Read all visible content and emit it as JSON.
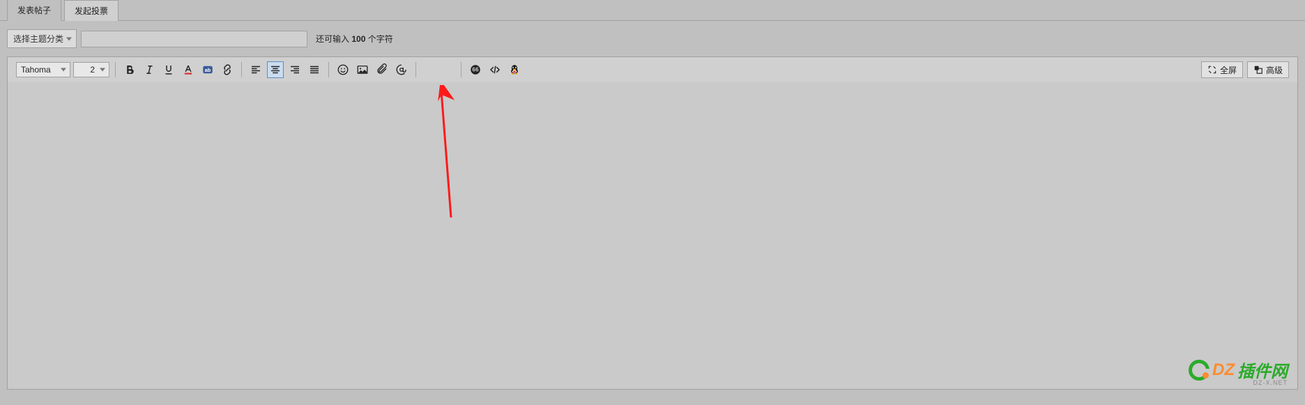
{
  "tabs": {
    "post": "发表帖子",
    "poll": "发起投票"
  },
  "subject": {
    "category_label": "选择主题分类",
    "value": "",
    "counter_prefix": "还可输入 ",
    "counter_num": "100",
    "counter_suffix": " 个字符"
  },
  "toolbar": {
    "font": "Tahoma",
    "size": "2",
    "fullscreen": "全屏",
    "advanced": "高级"
  },
  "watermark": {
    "t1": "DZ",
    "t2": "插件网",
    "sub": "DZ-X.NET"
  }
}
